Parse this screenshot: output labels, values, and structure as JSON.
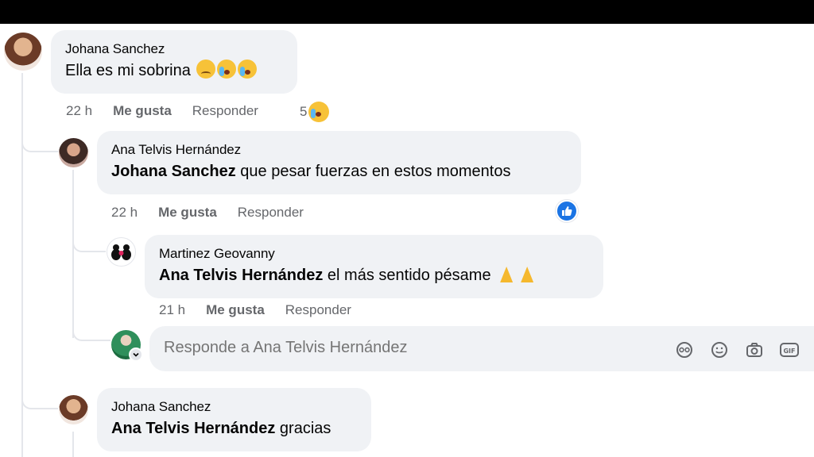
{
  "comments": [
    {
      "author": "Johana Sanchez",
      "text": "Ella es mi sobrina",
      "time": "22 h",
      "like_label": "Me gusta",
      "reply_label": "Responder",
      "reaction_count": "5",
      "emoji_icons": [
        "disappointed-face-icon",
        "crying-face-icon",
        "crying-face-icon"
      ]
    },
    {
      "author": "Ana Telvis Hernández",
      "mention": "Johana Sanchez",
      "text": "que pesar fuerzas en estos momentos",
      "time": "22 h",
      "like_label": "Me gusta",
      "reply_label": "Responder",
      "reaction_icon": "like-icon",
      "accent": "#1b74e4"
    },
    {
      "author": "Martinez Geovanny",
      "mention": "Ana Telvis Hernández",
      "text": "el más sentido pésame",
      "time": "21 h",
      "like_label": "Me gusta",
      "reply_label": "Responder",
      "emoji_icons": [
        "folded-hands-icon",
        "folded-hands-icon"
      ]
    },
    {
      "author": "Johana Sanchez",
      "mention": "Ana Telvis Hernández",
      "text": "gracias"
    }
  ],
  "reply_box": {
    "placeholder": "Responde a Ana Telvis Hernández",
    "tools": [
      "avatar-sticker-icon",
      "smiley-icon",
      "camera-icon",
      "gif-icon"
    ]
  },
  "colors": {
    "bubble": "#f0f2f5",
    "secondary_text": "#65676b",
    "like_blue": "#1b74e4"
  }
}
